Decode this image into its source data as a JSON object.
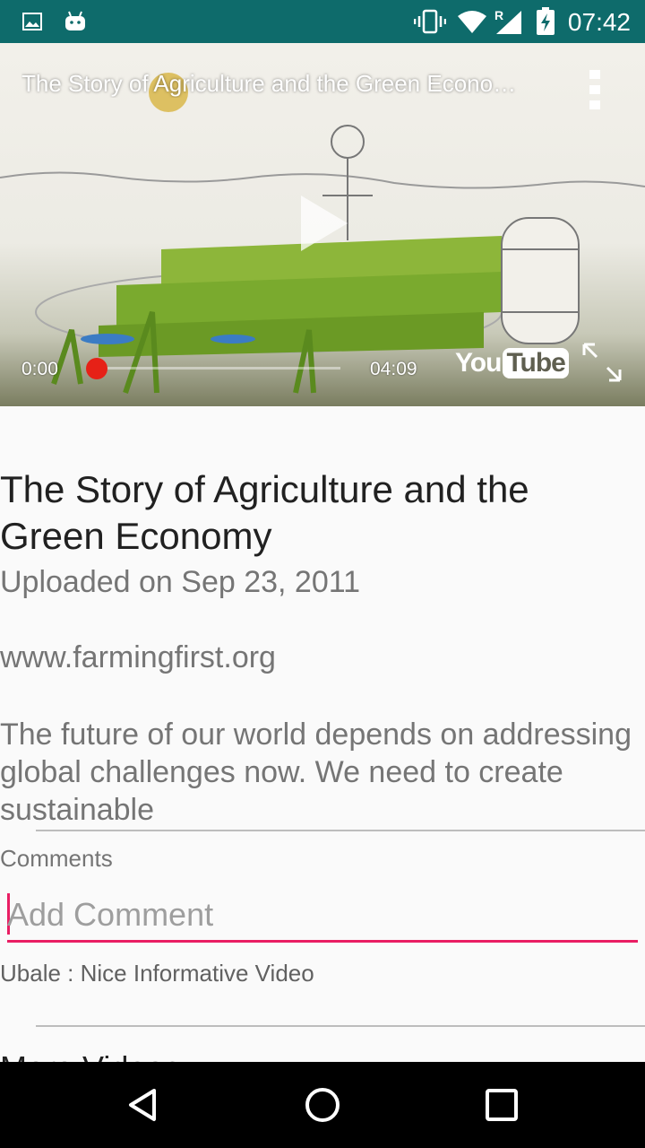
{
  "status_bar": {
    "time": "07:42",
    "icons": [
      "image-icon",
      "android-icon",
      "vibrate-icon",
      "wifi-icon",
      "signal-icon",
      "battery-charging-icon"
    ]
  },
  "video": {
    "title": "The Story of Agriculture and the Green Econo…",
    "current_time": "0:00",
    "duration": "04:09",
    "progress": 0.0,
    "logo_text_you": "You",
    "logo_text_tube": "Tube",
    "icons": [
      "overflow-menu-icon",
      "play-icon",
      "fullscreen-icon"
    ]
  },
  "details": {
    "title": "The Story of Agriculture and the Green Economy",
    "uploaded": "Uploaded on Sep 23, 2011",
    "link": "www.farmingfirst.org",
    "description": "The future of our world depends on addressing global challenges now. We need to create sustainable"
  },
  "comments": {
    "label": "Comments",
    "input_placeholder": "Add Comment",
    "input_value": "",
    "items": [
      {
        "text": "Ubale : Nice Informative Video"
      }
    ]
  },
  "more_heading": "More Videos",
  "colors": {
    "status_bar": "#0e6b6b",
    "accent": "#e91e63",
    "progress": "#e62117"
  },
  "nav": {
    "icons": [
      "back-icon",
      "home-icon",
      "recents-icon"
    ]
  }
}
